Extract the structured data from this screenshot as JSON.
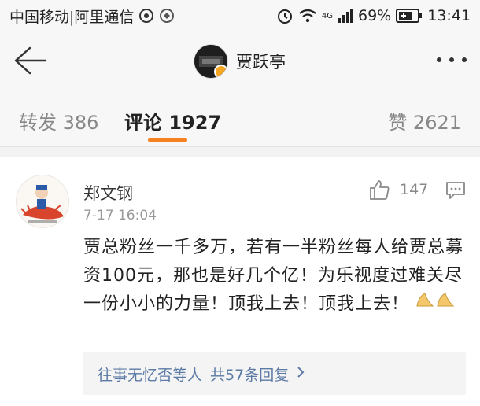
{
  "status_bar": {
    "carrier": "中国移动|阿里通信",
    "network": "4G",
    "battery": "69%",
    "time": "13:41"
  },
  "header": {
    "title": "贾跃亭"
  },
  "tabs": [
    {
      "label": "转发",
      "count": "386"
    },
    {
      "label": "评论",
      "count": "1927"
    },
    {
      "label": "赞",
      "count": "2621"
    }
  ],
  "comment": {
    "author": "郑文钢",
    "time": "7-17 16:04",
    "likes": "147",
    "text": "贾总粉丝一千多万，若有一半粉丝每人给贾总募资100元，那也是好几个亿！为乐视度过难关尽一份小小的力量！顶我上去！顶我上去！",
    "replies_preview": {
      "user": "往事无忆否等人",
      "summary": "共57条回复"
    }
  },
  "colors": {
    "accent": "#f58220",
    "link": "#5b7aa5"
  }
}
